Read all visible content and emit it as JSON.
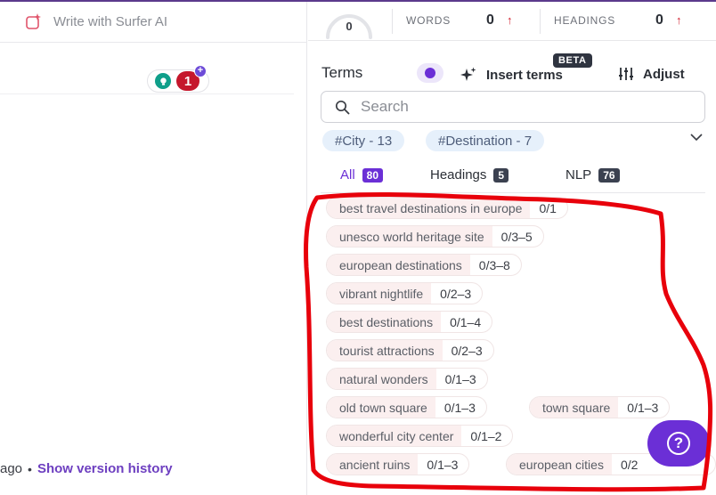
{
  "editor": {
    "write_ai_label": "Write with Surfer AI",
    "badge_count": "1",
    "history_prefix": "ago",
    "history_link": "Show version history"
  },
  "stats": {
    "score": "0",
    "words_label": "WORDS",
    "words_value": "0",
    "headings_label": "HEADINGS",
    "headings_value": "0",
    "arrow": "↑"
  },
  "terms": {
    "title": "Terms",
    "insert_label": "Insert terms",
    "beta_label": "BETA",
    "adjust_label": "Adjust",
    "search_placeholder": "Search",
    "hashtags": [
      "#City - 13",
      "#Destination - 7"
    ],
    "tabs": [
      {
        "label": "All",
        "count": "80"
      },
      {
        "label": "Headings",
        "count": "5"
      },
      {
        "label": "NLP",
        "count": "76"
      }
    ],
    "items": [
      {
        "name": "best travel destinations in europe",
        "count": "0/1"
      },
      {
        "name": "unesco world heritage site",
        "count": "0/3–5"
      },
      {
        "name": "european destinations",
        "count": "0/3–8"
      },
      {
        "name": "vibrant nightlife",
        "count": "0/2–3"
      },
      {
        "name": "best destinations",
        "count": "0/1–4"
      },
      {
        "name": "tourist attractions",
        "count": "0/2–3"
      },
      {
        "name": "natural wonders",
        "count": "0/1–3"
      },
      {
        "name": "old town square",
        "count": "0/1–3"
      },
      {
        "name": "town square",
        "count": "0/1–3"
      },
      {
        "name": "wonderful city center",
        "count": "0/1–2"
      },
      {
        "name": "ancient ruins",
        "count": "0/1–3"
      },
      {
        "name": "european cities",
        "count": "0/2"
      }
    ]
  },
  "help_label": "?",
  "colors": {
    "accent": "#6b2fd6",
    "badge_red": "#c5172c",
    "annotation_red": "#e8000b"
  }
}
